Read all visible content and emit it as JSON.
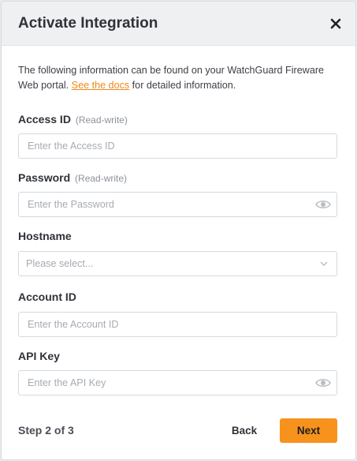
{
  "dialog": {
    "title": "Activate Integration",
    "close_icon": "close-icon"
  },
  "description": {
    "text_before": "The following information can be found on your WatchGuard Fireware Web portal. ",
    "link": "See the docs",
    "text_after": " for detailed information."
  },
  "fields": {
    "access_id": {
      "label": "Access ID",
      "hint": "(Read-write)",
      "placeholder": "Enter the Access ID",
      "value": ""
    },
    "password": {
      "label": "Password",
      "hint": "(Read-write)",
      "placeholder": "Enter the Password",
      "value": "",
      "icon": "eye-icon"
    },
    "hostname": {
      "label": "Hostname",
      "selected": "Please select...",
      "icon": "chevron-down-icon"
    },
    "account_id": {
      "label": "Account ID",
      "placeholder": "Enter the Account ID",
      "value": ""
    },
    "api_key": {
      "label": "API Key",
      "placeholder": "Enter the API Key",
      "value": "",
      "icon": "eye-icon"
    }
  },
  "footer": {
    "step": "Step 2 of 3",
    "back_label": "Back",
    "next_label": "Next"
  },
  "colors": {
    "accent": "#f7921c",
    "link": "#f0891a",
    "header_bg": "#eff0f2"
  }
}
